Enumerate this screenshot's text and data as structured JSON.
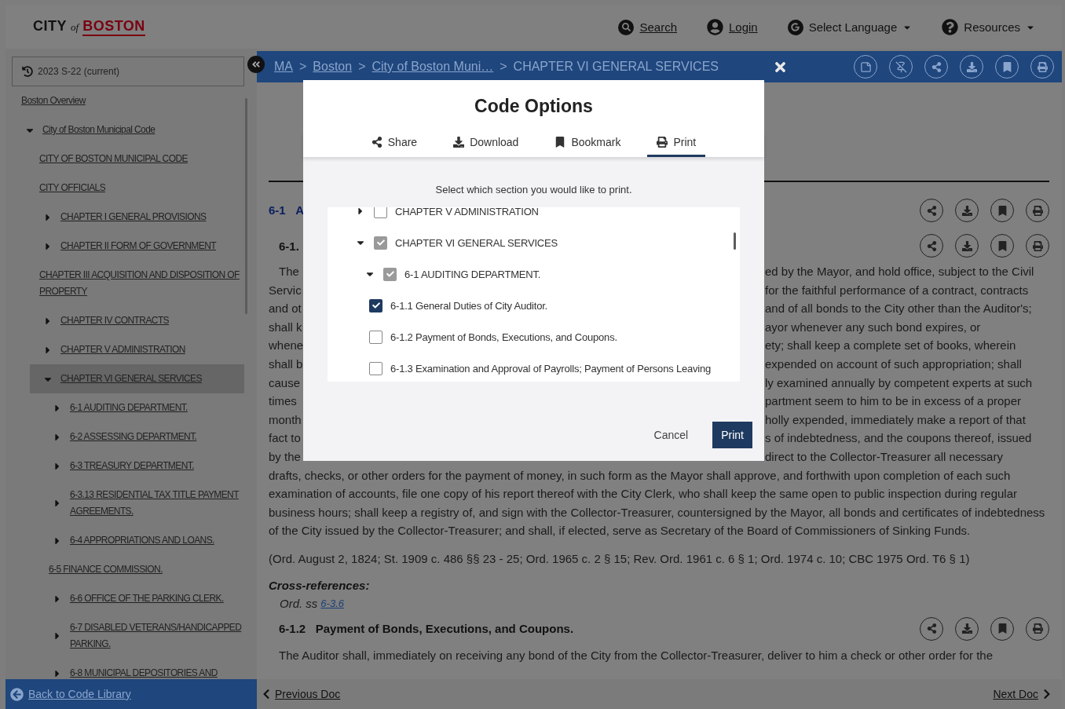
{
  "header": {
    "logo": {
      "city": "CITY",
      "of": "of",
      "boston": "BOSTON"
    },
    "nav": [
      {
        "kind": "search",
        "label": "Search",
        "dropdown": false
      },
      {
        "kind": "login",
        "label": "Login",
        "dropdown": false
      },
      {
        "kind": "language",
        "label": "Select Language",
        "dropdown": true
      },
      {
        "kind": "resources",
        "label": "Resources",
        "dropdown": true
      }
    ]
  },
  "sidebar": {
    "version": "2023 S-22 (current)",
    "tree": [
      {
        "kind": "leaf",
        "label": "Boston Overview",
        "selected": false
      },
      {
        "kind": "branch",
        "label": "City of Boston Municipal Code",
        "expanded": true,
        "selected": false,
        "children": [
          {
            "kind": "leaf",
            "label": "CITY OF BOSTON MUNICIPAL CODE",
            "selected": false
          },
          {
            "kind": "leaf",
            "label": "CITY OFFICIALS",
            "selected": false
          },
          {
            "kind": "branch",
            "label": "CHAPTER I GENERAL PROVISIONS",
            "expanded": false,
            "selected": false
          },
          {
            "kind": "branch",
            "label": "CHAPTER II FORM OF GOVERNMENT",
            "expanded": false,
            "selected": false
          },
          {
            "kind": "leaf",
            "label": "CHAPTER III ACQUISITION AND DISPOSITION OF PROPERTY",
            "selected": false
          },
          {
            "kind": "branch",
            "label": "CHAPTER IV CONTRACTS",
            "expanded": false,
            "selected": false
          },
          {
            "kind": "branch",
            "label": "CHAPTER V ADMINISTRATION",
            "expanded": false,
            "selected": false
          },
          {
            "kind": "branch",
            "label": "CHAPTER VI GENERAL SERVICES",
            "expanded": true,
            "selected": true,
            "children": [
              {
                "kind": "branch",
                "label": "6-1 AUDITING DEPARTMENT.",
                "expanded": false,
                "selected": false
              },
              {
                "kind": "branch",
                "label": "6-2 ASSESSING DEPARTMENT.",
                "expanded": false,
                "selected": false
              },
              {
                "kind": "branch",
                "label": "6-3 TREASURY DEPARTMENT.",
                "expanded": false,
                "selected": false
              },
              {
                "kind": "branch",
                "label": "6-3.13 RESIDENTIAL TAX TITLE PAYMENT AGREEMENTS.",
                "expanded": false,
                "selected": false
              },
              {
                "kind": "branch",
                "label": "6-4 APPROPRIATIONS AND LOANS.",
                "expanded": false,
                "selected": false
              },
              {
                "kind": "leaf",
                "label": "6-5 FINANCE COMMISSION.",
                "selected": false
              },
              {
                "kind": "branch",
                "label": "6-6 OFFICE OF THE PARKING CLERK.",
                "expanded": false,
                "selected": false
              },
              {
                "kind": "branch",
                "label": "6-7 DISABLED VETERANS/HANDICAPPED PARKING.",
                "expanded": false,
                "selected": false
              },
              {
                "kind": "branch",
                "label": "6-8 MUNICIPAL DEPOSITORIES AND",
                "expanded": false,
                "selected": false
              }
            ]
          }
        ]
      }
    ],
    "back_link": "Back to Code Library"
  },
  "breadcrumb": [
    {
      "kind": "link",
      "label": "MA"
    },
    {
      "kind": "separator",
      "label": ">"
    },
    {
      "kind": "link",
      "label": "Boston"
    },
    {
      "kind": "separator",
      "label": ">"
    },
    {
      "kind": "link",
      "label": "City of Boston Muni…"
    },
    {
      "kind": "separator",
      "label": ">"
    },
    {
      "kind": "current",
      "label": "CHAPTER VI GENERAL SERVICES"
    }
  ],
  "document": {
    "heading": {
      "number": "6-1",
      "fragment": "A"
    },
    "subheading": "6-1.",
    "covered_lines": [
      {
        "left": "The",
        "right": "ed by the Mayor, and hold office, subject to the Civil"
      },
      {
        "left": "Servic",
        "right": "for the faithful performance of a contract, contracts"
      },
      {
        "left": "and ot",
        "right": "and of all bonds to the City other than the Auditor's;"
      },
      {
        "left": "shall k",
        "right": "ayor whenever any such bond expires, or"
      },
      {
        "left": "whene",
        "right": "ety; shall keep a complete set of books, wherein"
      },
      {
        "left": "shall b",
        "right": "expended on account of such appropriation; shall"
      },
      {
        "left": "cause",
        "right": "ly examined annually by competent experts at such"
      },
      {
        "left": "times",
        "right": "partment seem to him to be in excess of a proper"
      },
      {
        "left": "month",
        "right": "holly expended, immediately make a report of that"
      },
      {
        "left": "fact to",
        "right": "s of indebtedness, and the coupons thereof, issued"
      },
      {
        "left": "by the",
        "right": "direct to the Collector-Treasurer all necessary"
      }
    ],
    "paragraph": "drafts, checks, or other orders for the payment of money, in such form as the Mayor shall approve, and forthwith upon completion of each such examination of accounts, file one copy of his report thereof with the City Clerk, who shall keep the same open to public inspection during regular business hours; shall keep a registry of, and sign with the Collector-Treasurer, countersigned by the Mayor, all bonds and certificates of indebtedness of the City issued by the Collector-Treasurer; and shall, if elected, serve as Secretary of the Board of Commissioners of Sinking Funds.",
    "citation": "(Ord. August 2, 1824; St. 1909 c. 486 §§ 23 - 25; Ord. 1965 c. 2 § 15; Rev. Ord. 1961 c. 6 § 1; Ord. 1974 c. 10; CBC 1975 Ord. T6 § 1)",
    "cross_ref_title": "Cross-references:",
    "cross_ref_prefix": "Ord. ss",
    "cross_ref_link": "6-3.6",
    "next_section": {
      "number": "6-1.2",
      "title": "Payment of Bonds, Executions, and Coupons."
    },
    "next_text": "The Auditor shall, immediately on receiving any bond of the City from the Collector-Treasurer, deliver to him a check or other order for the"
  },
  "footer": {
    "previous": "Previous Doc",
    "next": "Next Doc"
  },
  "modal": {
    "title": "Code Options",
    "tabs": [
      {
        "kind": "share",
        "label": "Share",
        "selected": false
      },
      {
        "kind": "download",
        "label": "Download",
        "selected": false
      },
      {
        "kind": "bookmark",
        "label": "Bookmark",
        "selected": false
      },
      {
        "kind": "print",
        "label": "Print",
        "selected": true
      }
    ],
    "instruction": "Select which section you would like to print.",
    "tree": [
      {
        "kind": "branch",
        "label": "CHAPTER V ADMINISTRATION",
        "expanded": false,
        "checked": false,
        "disabled": false
      },
      {
        "kind": "branch",
        "label": "CHAPTER VI GENERAL SERVICES",
        "expanded": true,
        "checked": true,
        "disabled": true,
        "children": [
          {
            "kind": "branch",
            "label": "6-1 AUDITING DEPARTMENT.",
            "expanded": true,
            "checked": true,
            "disabled": true,
            "children": [
              {
                "kind": "leaf",
                "label": "6-1.1 General Duties of City Auditor.",
                "checked": true,
                "disabled": false
              },
              {
                "kind": "leaf",
                "label": "6-1.2 Payment of Bonds, Executions, and Coupons.",
                "checked": false,
                "disabled": false
              },
              {
                "kind": "leaf",
                "label": "6-1.3 Examination and Approval of Payrolls; Payment of Persons Leaving",
                "checked": false,
                "disabled": false
              }
            ]
          }
        ]
      }
    ],
    "buttons": [
      {
        "kind": "secondary",
        "label": "Cancel"
      },
      {
        "kind": "primary",
        "label": "Print"
      }
    ]
  }
}
